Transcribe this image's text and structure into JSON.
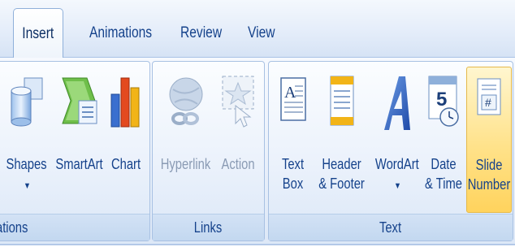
{
  "tabs": [
    {
      "label": "Insert",
      "active": true
    },
    {
      "label": "Animations",
      "active": false
    },
    {
      "label": "Review",
      "active": false
    },
    {
      "label": "View",
      "active": false
    }
  ],
  "groups": {
    "illustrations": {
      "label": "ations",
      "buttons": {
        "shapes": {
          "label": "Shapes",
          "icon": "shapes-icon",
          "has_dropdown": true,
          "dropdown_glyph": "▼"
        },
        "smartart": {
          "label": "SmartArt",
          "icon": "smartart-icon"
        },
        "chart": {
          "label": "Chart",
          "icon": "chart-icon"
        }
      }
    },
    "links": {
      "label": "Links",
      "buttons": {
        "hyperlink": {
          "label": "Hyperlink",
          "icon": "hyperlink-icon",
          "disabled": true
        },
        "action": {
          "label": "Action",
          "icon": "action-icon",
          "disabled": true
        }
      }
    },
    "text": {
      "label": "Text",
      "buttons": {
        "text_box": {
          "line1": "Text",
          "line2": "Box",
          "icon": "text-box-icon"
        },
        "header_footer": {
          "line1": "Header",
          "line2": "& Footer",
          "icon": "header-footer-icon"
        },
        "wordart": {
          "label": "WordArt",
          "icon": "wordart-icon",
          "has_dropdown": true,
          "dropdown_glyph": "▼"
        },
        "date_time": {
          "line1": "Date",
          "line2": "& Time",
          "icon": "date-time-icon",
          "icon_text": "5"
        },
        "slide_number": {
          "line1": "Slide",
          "line2": "Number",
          "icon": "slide-number-icon",
          "icon_text": "#",
          "selected": true
        }
      }
    }
  },
  "colors": {
    "label_text": "#15428b",
    "selected_fill": "#ffd35d",
    "ribbon_border": "#a8c1e3"
  }
}
